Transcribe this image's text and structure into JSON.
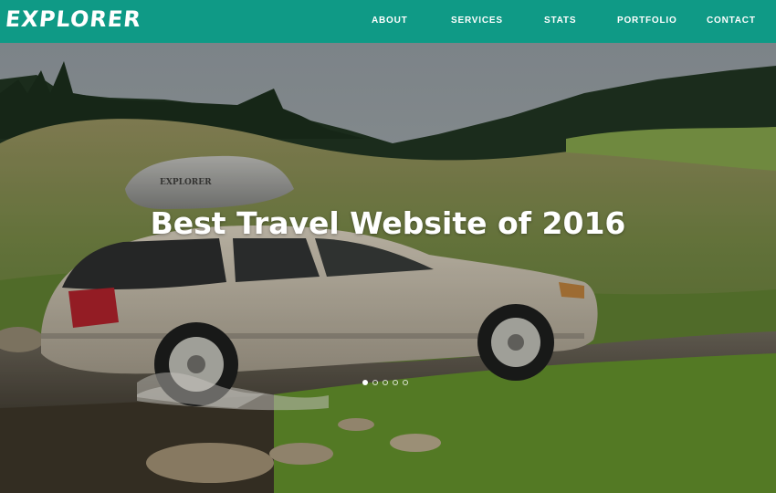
{
  "brand": {
    "logo_text": "EXPLORER"
  },
  "nav": {
    "items": [
      {
        "label": "ABOUT"
      },
      {
        "label": "SERVICES"
      },
      {
        "label": "STATS"
      },
      {
        "label": "PORTFOLIO"
      },
      {
        "label": "CONTACT"
      }
    ]
  },
  "hero": {
    "headline": "Best Travel Website of 2016",
    "cargo_box_text": "EXPLORER",
    "slides": {
      "count": 5,
      "active": 1
    }
  },
  "colors": {
    "navbar": "#0f9a86",
    "text": "#ffffff"
  }
}
